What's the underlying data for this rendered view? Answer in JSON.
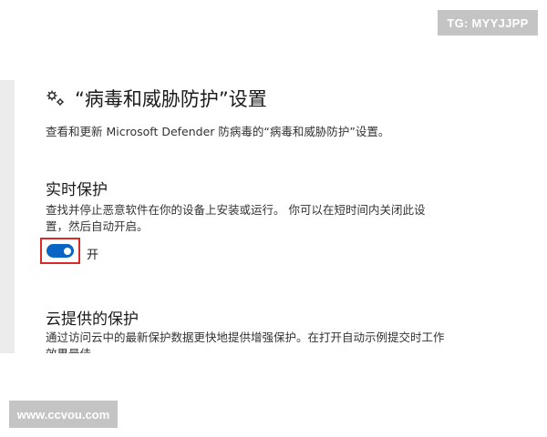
{
  "badge_top": "TG: MYYJJPP",
  "header": {
    "icon": "gear-icon",
    "title": "“病毒和威胁防护”设置",
    "description": "查看和更新 Microsoft Defender 防病毒的“病毒和威胁防护”设置。"
  },
  "realtime_protection": {
    "title": "实时保护",
    "description": "查找并停止恶意软件在你的设备上安装或运行。 你可以在短时间内关闭此设置，然后自动开启。",
    "toggle": {
      "state": "on",
      "state_label": "开"
    }
  },
  "cloud_protection": {
    "title": "云提供的保护",
    "description": "通过访问云中的最新保护数据更快地提供增强保护。在打开自动示例提交时工作效果最佳。"
  },
  "watermark": "www.ccvou.com",
  "colors": {
    "toggle_on": "#0a64c4",
    "highlight_border": "#d92a2a",
    "badge_bg": "#c4c4c4"
  }
}
